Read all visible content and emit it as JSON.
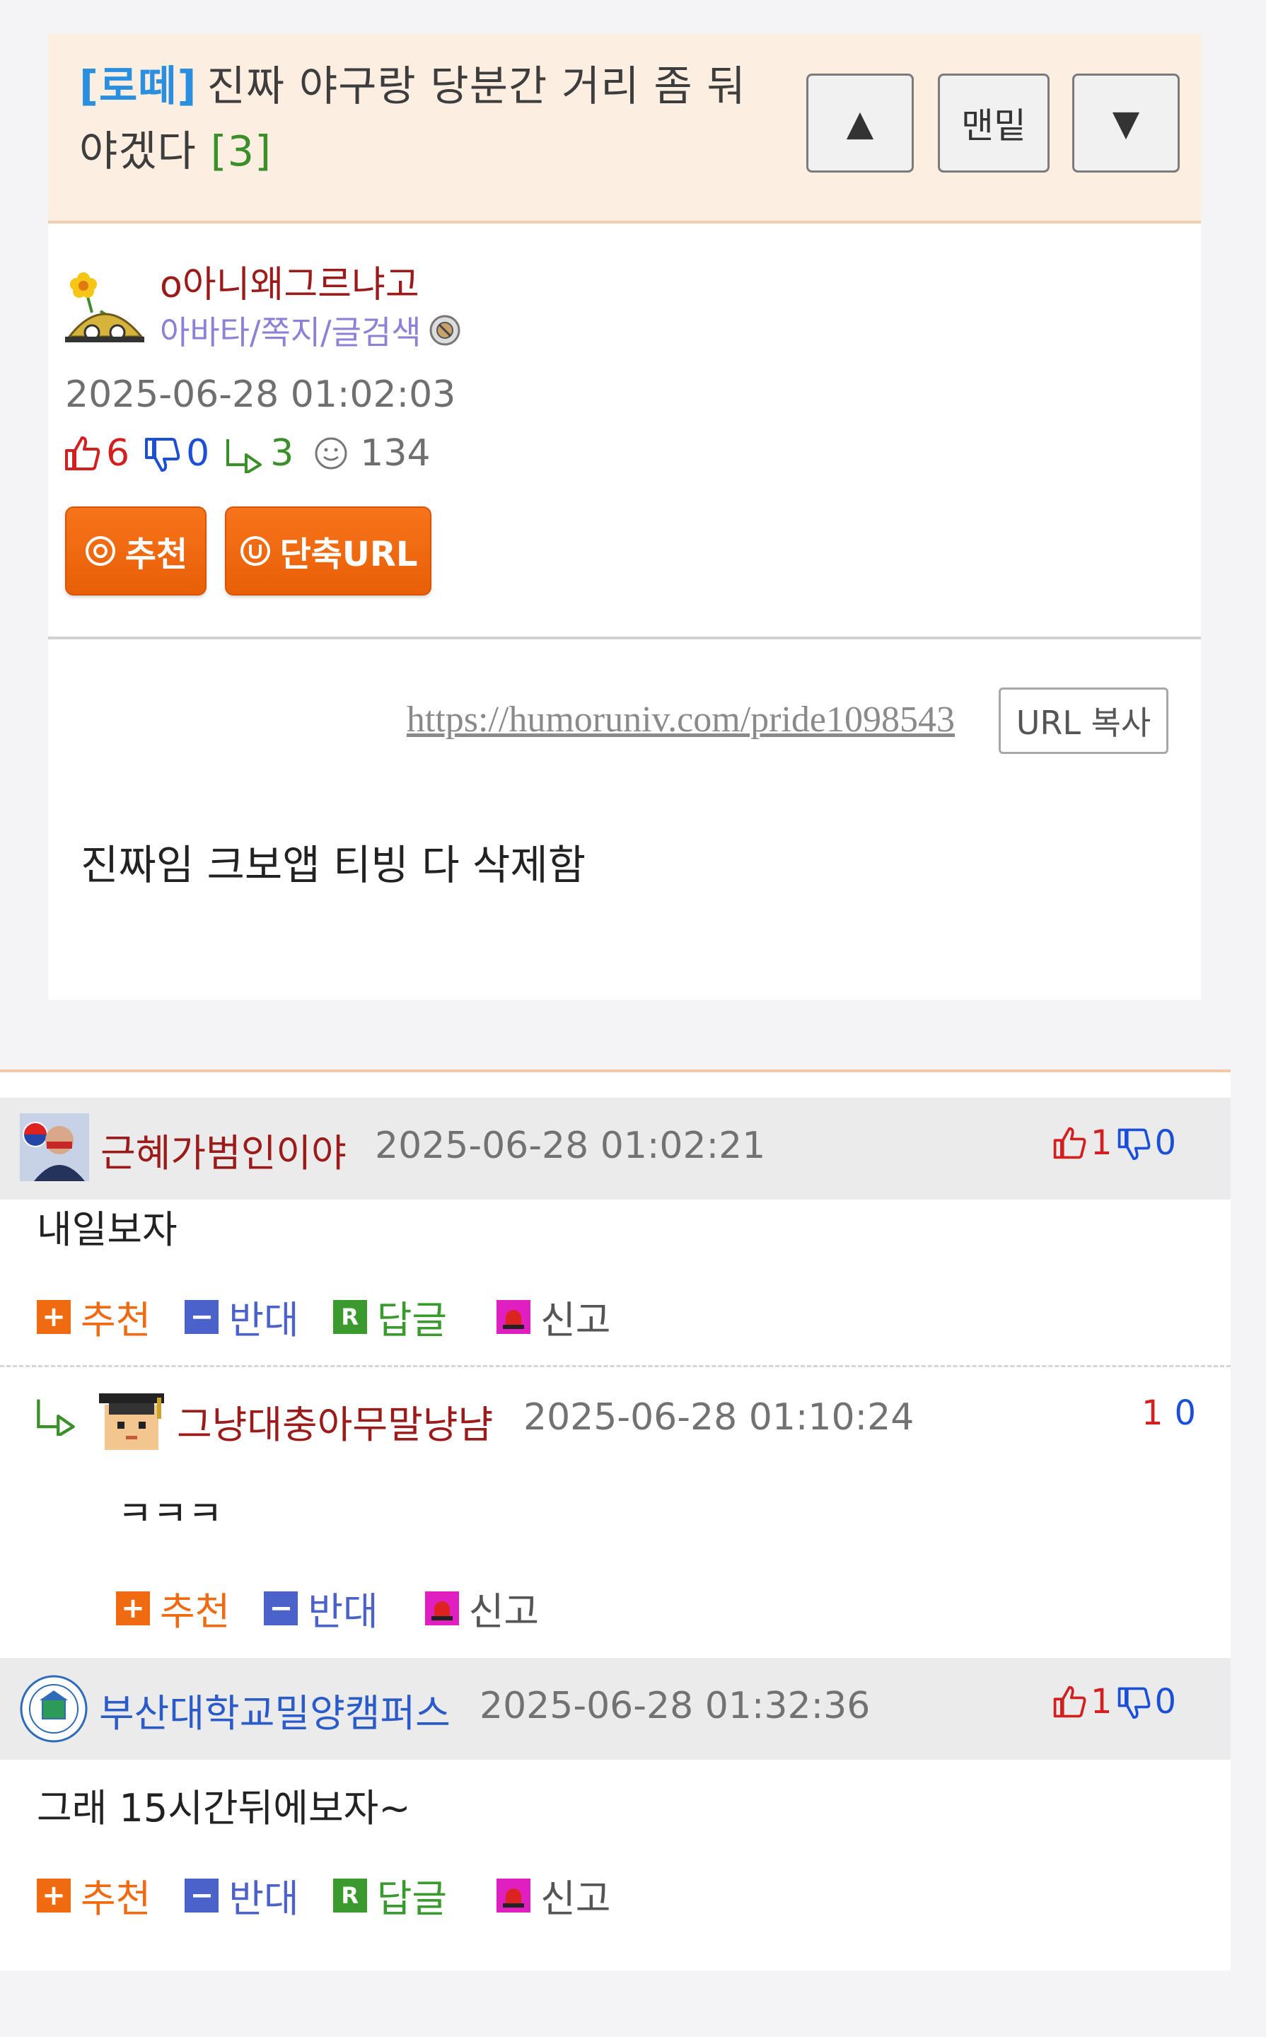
{
  "post": {
    "category": "[로떼]",
    "title": "진짜 야구랑 당분간 거리 좀 둬야겠다",
    "reply_count": "[3]",
    "nav": {
      "up": "▲",
      "bottom": "맨밑",
      "down": "▼"
    },
    "author": "o아니왜그르냐고",
    "author_links": "아바타/쪽지/글검색",
    "date": "2025-06-28 01:02:03",
    "stats": {
      "likes": "6",
      "dislikes": "0",
      "replies": "3",
      "views": "134"
    },
    "buttons": {
      "recommend": "추천",
      "short_url": "단축URL"
    },
    "url": "https://humoruniv.com/pride1098543",
    "url_copy": "URL 복사",
    "body": "진짜임 크보앱 티빙 다 삭제함"
  },
  "comments": [
    {
      "nick": "근혜가범인이야",
      "date": "2025-06-28 01:02:21",
      "likes": "1",
      "dislikes": "0",
      "text": "내일보자",
      "actions": {
        "recommend": "추천",
        "oppose": "반대",
        "reply": "답글",
        "report": "신고"
      }
    },
    {
      "nick": "그냥대충아무말냥냠",
      "date": "2025-06-28 01:10:24",
      "likes": "1",
      "dislikes": "0",
      "text": "ㅋㅋㅋ",
      "actions": {
        "recommend": "추천",
        "oppose": "반대",
        "report": "신고"
      }
    },
    {
      "nick": "부산대학교밀양캠퍼스",
      "date": "2025-06-28 01:32:36",
      "likes": "1",
      "dislikes": "0",
      "text": "그래 15시간뒤에보자~",
      "actions": {
        "recommend": "추천",
        "oppose": "반대",
        "reply": "답글",
        "report": "신고"
      }
    }
  ],
  "icons": {
    "like": "thumbs-up-icon",
    "dislike": "thumbs-down-icon",
    "reply": "reply-arrow-icon",
    "views": "smiley-icon"
  },
  "colors": {
    "orange": "#ef6a10",
    "like_red": "#d21f1f",
    "dislike_blue": "#1b4fd6",
    "reply_green": "#3a8f2b"
  }
}
